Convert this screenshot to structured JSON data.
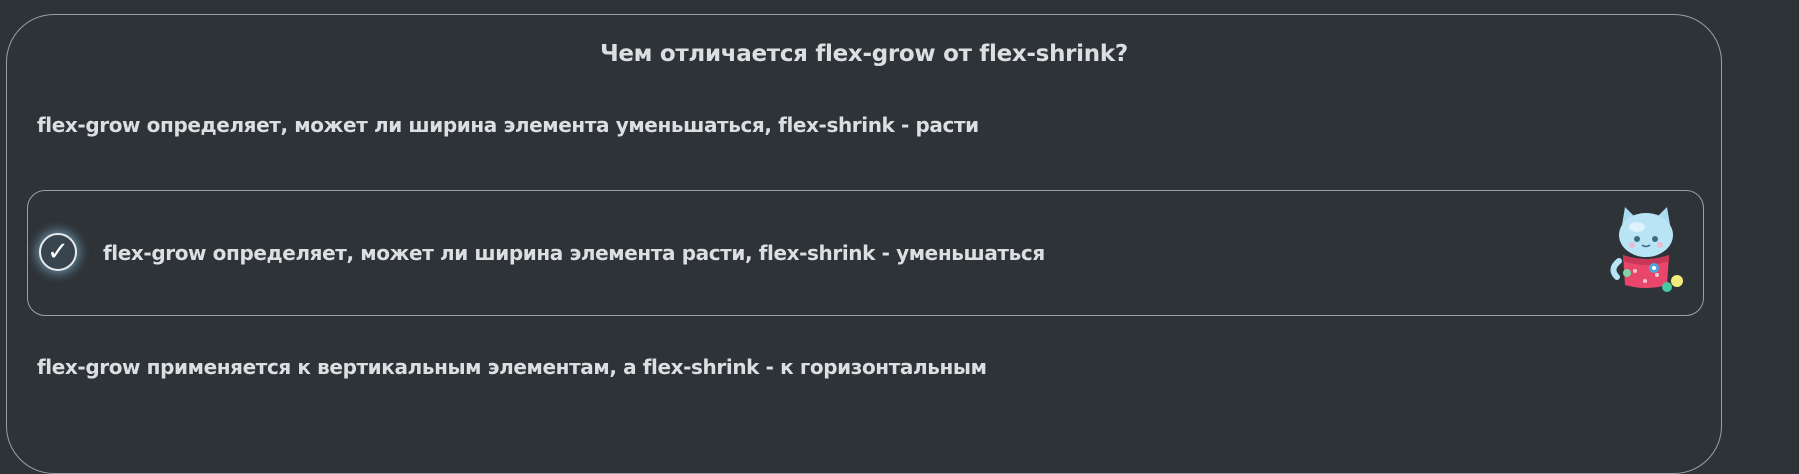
{
  "question": {
    "title": "Чем отличается flex-grow от flex-shrink?"
  },
  "options": [
    {
      "label": "flex-grow определяет, может ли ширина элемента уменьшаться, flex-shrink - расти",
      "selected": false
    },
    {
      "label": "flex-grow определяет, может ли ширина элемента расти, flex-shrink - уменьшаться",
      "selected": true
    },
    {
      "label": "flex-grow применяется к вертикальным элементам, а flex-shrink - к горизонтальным",
      "selected": false
    }
  ],
  "icons": {
    "check": "check-mark-icon",
    "mascot": "cat-mascot-icon"
  },
  "colors": {
    "background": "#2e3337",
    "text": "#dcdfe2",
    "border": "#9aa0a5",
    "check_glow": "#8cc8eb"
  }
}
